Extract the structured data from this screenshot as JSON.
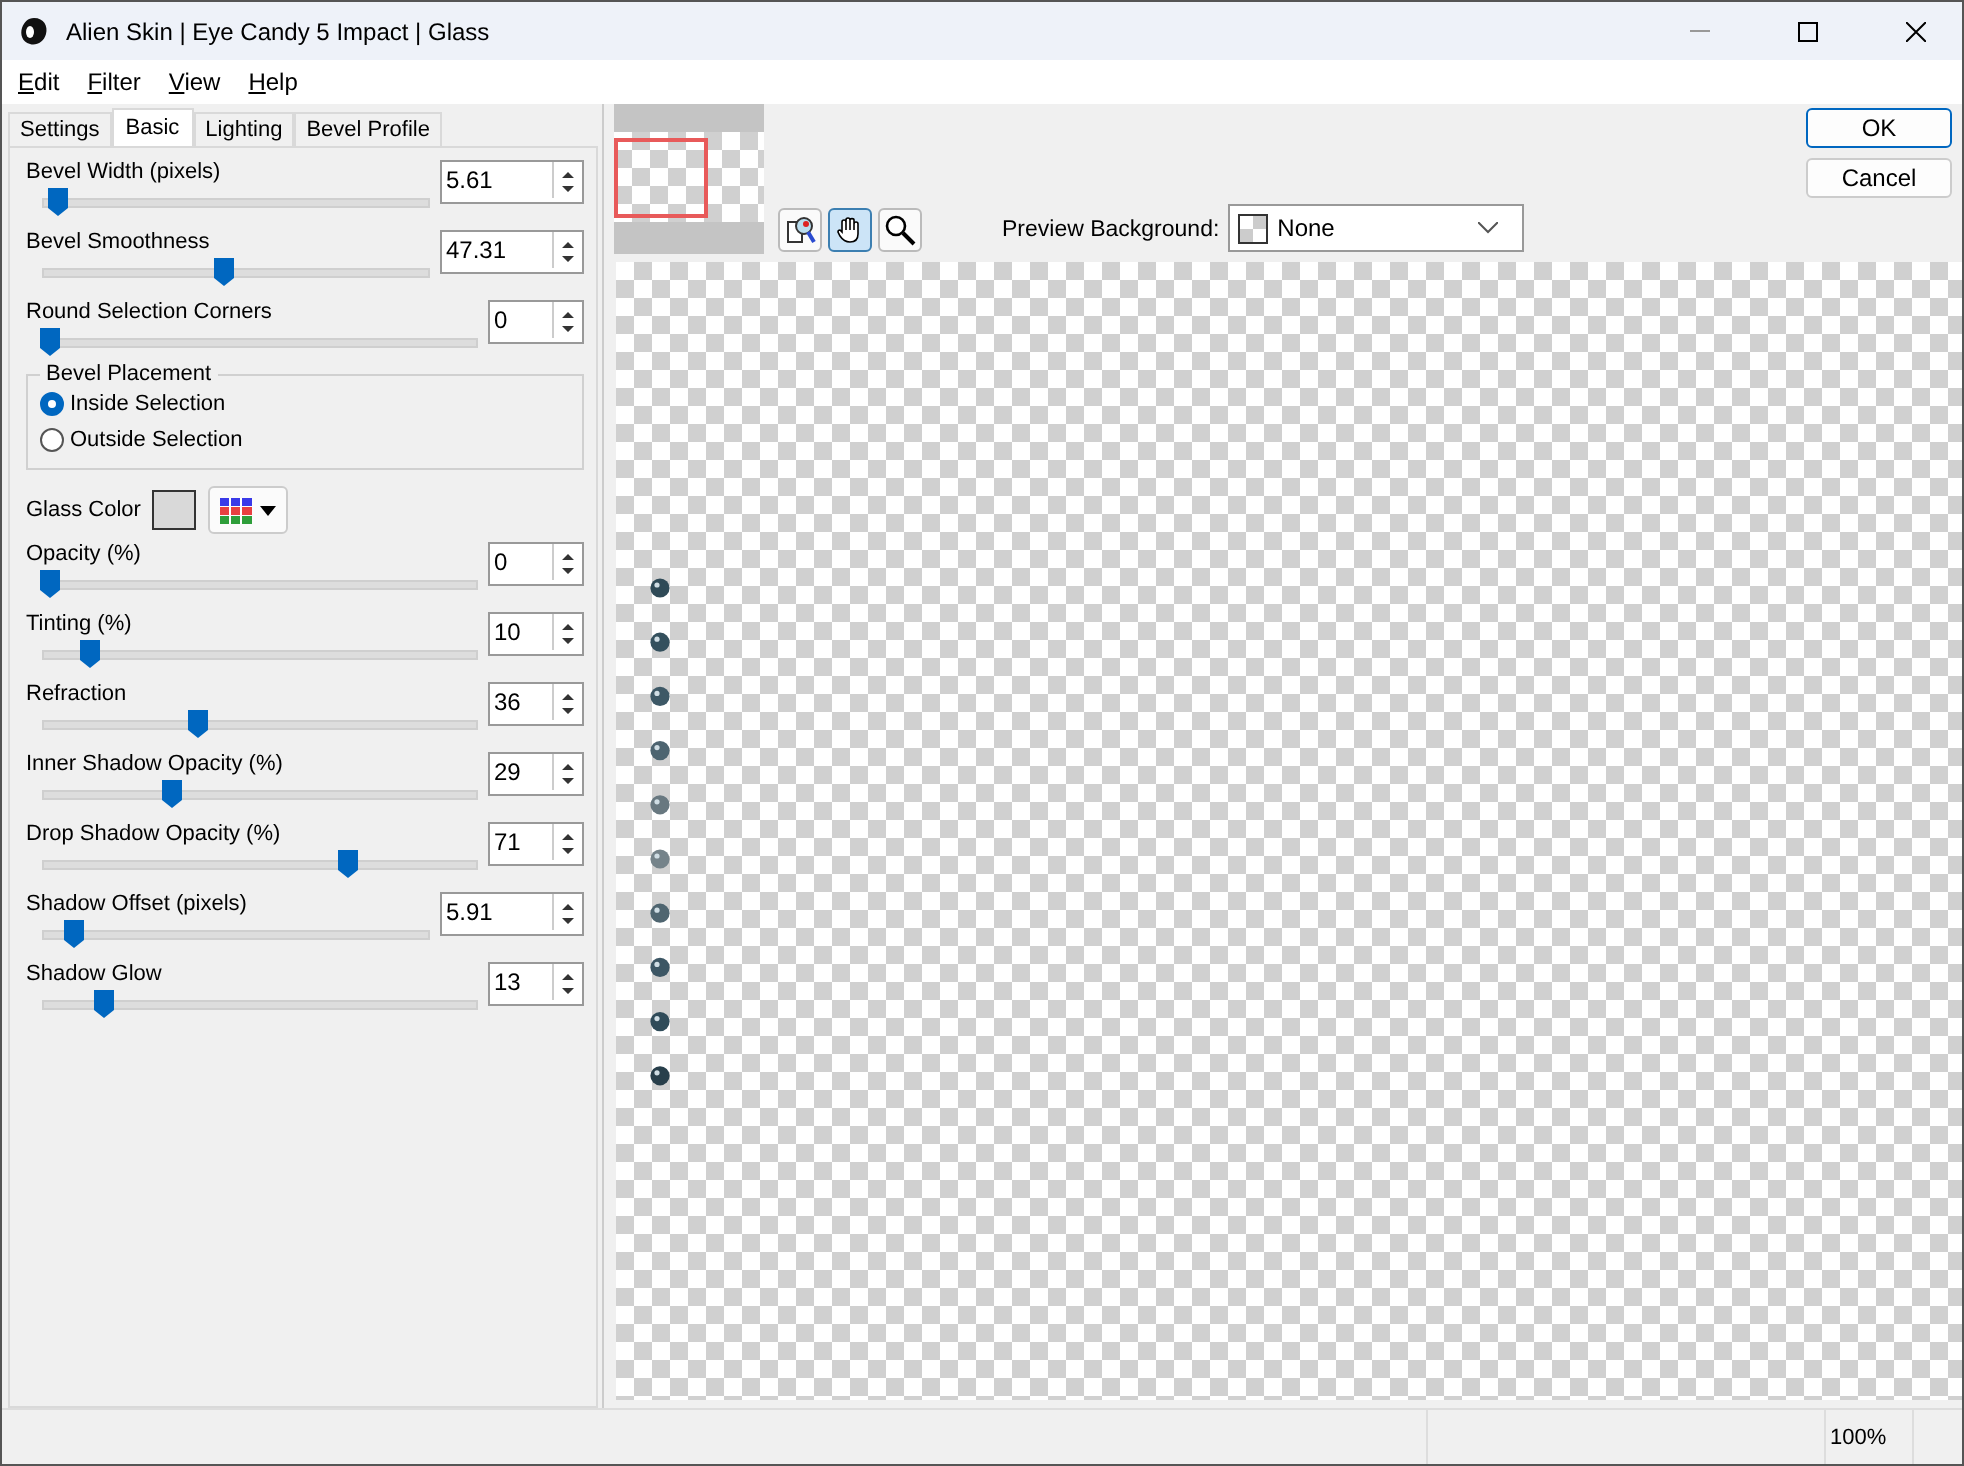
{
  "window": {
    "title": "Alien Skin | Eye Candy 5 Impact | Glass"
  },
  "menu": [
    "Edit",
    "Filter",
    "View",
    "Help"
  ],
  "tabs": [
    {
      "label": "Settings",
      "selected": false
    },
    {
      "label": "Basic",
      "selected": true
    },
    {
      "label": "Lighting",
      "selected": false
    },
    {
      "label": "Bevel Profile",
      "selected": false
    }
  ],
  "sliders_top": [
    {
      "label": "Bevel Width (pixels)",
      "value": "5.61",
      "level": 0.04,
      "kind": "decimal"
    },
    {
      "label": "Bevel Smoothness",
      "value": "47.31",
      "level": 0.47,
      "kind": "decimal"
    },
    {
      "label": "Round Selection Corners",
      "value": "0",
      "level": 0.02,
      "kind": "integer"
    }
  ],
  "bevel_placement": {
    "title": "Bevel Placement",
    "options": [
      {
        "label": "Inside Selection",
        "selected": true
      },
      {
        "label": "Outside Selection",
        "selected": false
      }
    ]
  },
  "glass_color": {
    "label": "Glass Color",
    "color": "#d9d9d9"
  },
  "sliders_bottom": [
    {
      "label": "Opacity (%)",
      "value": "0",
      "level": 0.02,
      "kind": "integer"
    },
    {
      "label": "Tinting (%)",
      "value": "10",
      "level": 0.11,
      "kind": "integer"
    },
    {
      "label": "Refraction",
      "value": "36",
      "level": 0.36,
      "kind": "integer"
    },
    {
      "label": "Inner Shadow Opacity (%)",
      "value": "29",
      "level": 0.3,
      "kind": "integer"
    },
    {
      "label": "Drop Shadow Opacity (%)",
      "value": "71",
      "level": 0.7,
      "kind": "integer"
    },
    {
      "label": "Shadow Offset (pixels)",
      "value": "5.91",
      "level": 0.08,
      "kind": "decimal"
    },
    {
      "label": "Shadow Glow",
      "value": "13",
      "level": 0.14,
      "kind": "integer"
    }
  ],
  "preview_background": {
    "label": "Preview Background:",
    "value": "None"
  },
  "buttons": [
    "OK",
    "Cancel"
  ],
  "status_bar": {
    "zoom": "100%"
  }
}
